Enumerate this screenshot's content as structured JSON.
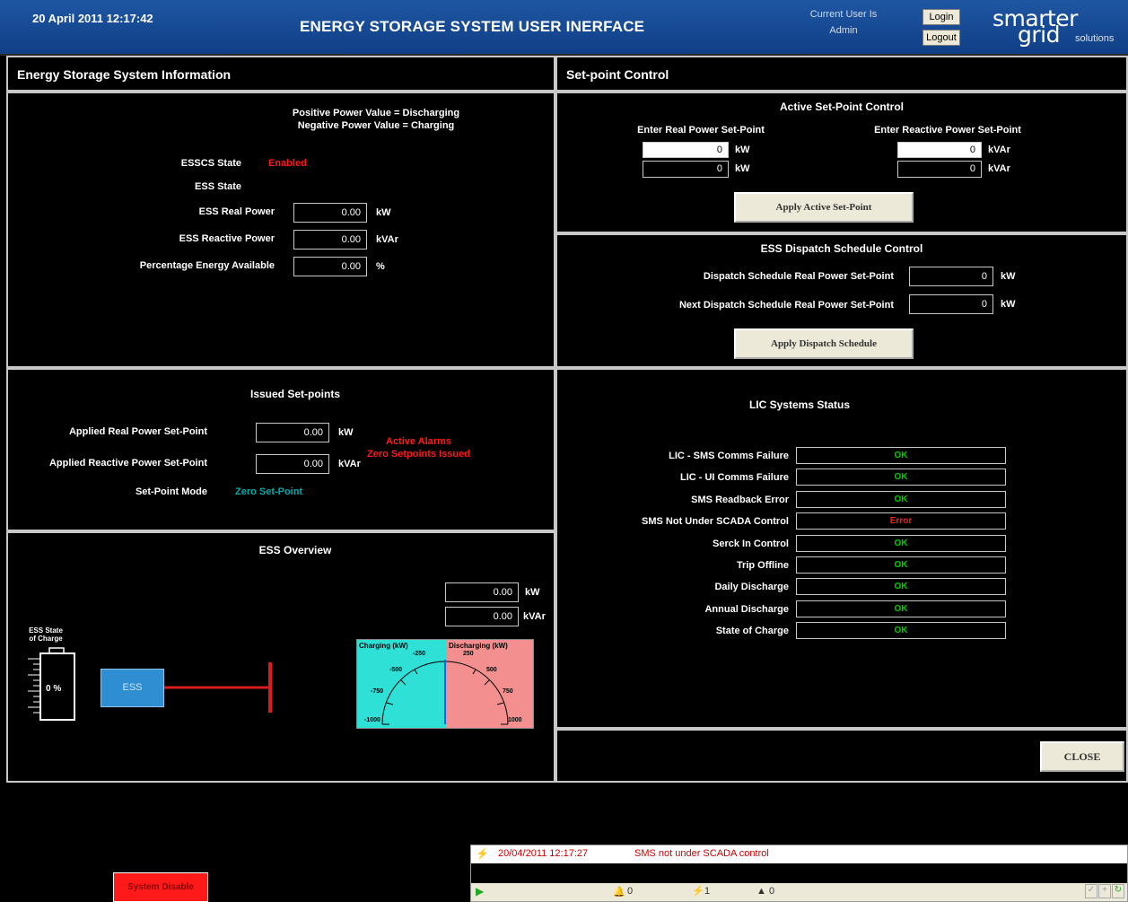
{
  "header": {
    "datetime": "20 April 2011 12:17:42",
    "title": "ENERGY STORAGE SYSTEM USER INERFACE",
    "current_user_label": "Current User Is",
    "current_user": "Admin",
    "login_label": "Login",
    "logout_label": "Logout",
    "logo": {
      "line1": "smarter",
      "line2": "grid",
      "line3": "solutions"
    }
  },
  "info_panel": {
    "title": "Energy Storage System Information",
    "note1": "Positive Power Value = Discharging",
    "note2": "Negative Power Value = Charging",
    "esscs_state_label": "ESSCS State",
    "esscs_state_value": "Enabled",
    "ess_state_label": "ESS State",
    "real_power_label": "ESS Real Power",
    "real_power_value": "0.00",
    "real_power_unit": "kW",
    "reactive_power_label": "ESS Reactive Power",
    "reactive_power_value": "0.00",
    "reactive_power_unit": "kVAr",
    "energy_label": "Percentage Energy Available",
    "energy_value": "0.00",
    "energy_unit": "%"
  },
  "setpoint_panel": {
    "title": "Set-point Control",
    "active_title": "Active Set-Point Control",
    "real_label": "Enter Real Power Set-Point",
    "reactive_label": "Enter Reactive Power Set-Point",
    "real_input": "0",
    "real_current": "0",
    "real_unit": "kW",
    "reactive_input": "0",
    "reactive_current": "0",
    "reactive_unit": "kVAr",
    "apply_active_label": "Apply Active Set-Point",
    "dispatch_title": "ESS Dispatch Schedule Control",
    "dispatch_label": "Dispatch Schedule Real Power Set-Point",
    "dispatch_value": "0",
    "dispatch_unit": "kW",
    "next_dispatch_label": "Next Dispatch Schedule Real Power Set-Point",
    "next_dispatch_value": "0",
    "next_dispatch_unit": "kW",
    "apply_dispatch_label": "Apply Dispatch Schedule"
  },
  "issued_panel": {
    "title": "Issued Set-points",
    "applied_real_label": "Applied Real Power Set-Point",
    "applied_real_value": "0.00",
    "applied_real_unit": "kW",
    "applied_reactive_label": "Applied Reactive Power Set-Point",
    "applied_reactive_value": "0.00",
    "applied_reactive_unit": "kVAr",
    "mode_label": "Set-Point Mode",
    "mode_value": "Zero Set-Point",
    "alarm1": "Active Alarms",
    "alarm2": "Zero Setpoints Issued"
  },
  "overview_panel": {
    "title": "ESS Overview",
    "kw_value": "0.00",
    "kw_unit": "kW",
    "kvar_value": "0.00",
    "kvar_unit": "kVAr",
    "soc_label1": "ESS State",
    "soc_label2": "of Charge",
    "soc_value": "0 %",
    "ess_label": "ESS",
    "gauge_charging": "Charging (kW)",
    "gauge_discharging": "Discharging (kW)",
    "gauge_ticks_left": [
      "-250",
      "-500",
      "-750",
      "-1000"
    ],
    "gauge_ticks_right": [
      "250",
      "500",
      "750",
      "1000"
    ],
    "gauge_value": 0
  },
  "lic_panel": {
    "title": "LIC Systems Status",
    "items": [
      {
        "label": "LIC - SMS Comms Failure",
        "value": "OK"
      },
      {
        "label": "LIC - UI Comms Failure",
        "value": "OK"
      },
      {
        "label": "SMS Readback Error",
        "value": "OK"
      },
      {
        "label": "SMS Not Under SCADA Control",
        "value": "Error"
      },
      {
        "label": "Serck In Control",
        "value": "OK"
      },
      {
        "label": "Trip Offline",
        "value": "OK"
      },
      {
        "label": "Daily Discharge",
        "value": "OK"
      },
      {
        "label": "Annual Discharge",
        "value": "OK"
      },
      {
        "label": "State of Charge",
        "value": "OK"
      }
    ]
  },
  "close_label": "CLOSE",
  "system_disable_label": "System Disable",
  "alarm_bar": {
    "timestamp": "20/04/2011 12:17:27",
    "message": "SMS not under SCADA control",
    "count_bell": "0",
    "count_alarm": "1",
    "count_other": "0"
  },
  "colors": {
    "ok": "#00cc00",
    "error": "#ff1a1a",
    "mode": "#00a8a8",
    "header": "#1f56a3",
    "ess_box": "#2f8ed1",
    "line": "#d91c1c"
  }
}
